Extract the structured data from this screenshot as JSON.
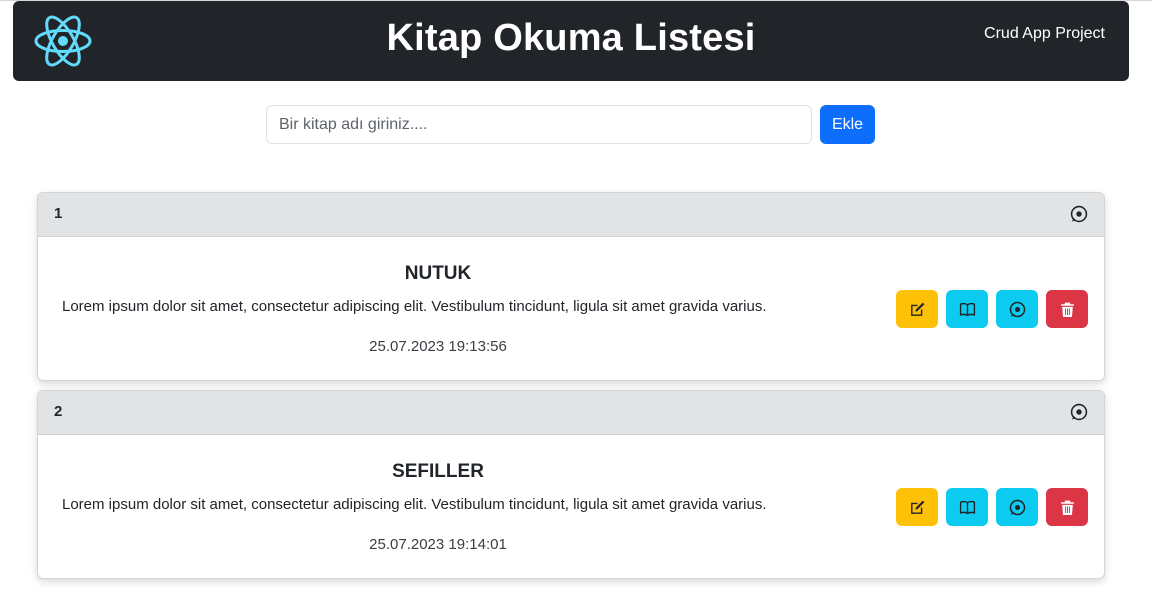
{
  "header": {
    "title": "Kitap Okuma Listesi",
    "link": "Crud App Project"
  },
  "add_form": {
    "placeholder": "Bir kitap adı giriniz....",
    "value": "",
    "button_label": "Ekle"
  },
  "books": [
    {
      "index": "1",
      "title": "NUTUK",
      "description": "Lorem ipsum dolor sit amet, consectetur adipiscing elit. Vestibulum tincidunt, ligula sit amet gravida varius.",
      "date": "25.07.2023 19:13:56"
    },
    {
      "index": "2",
      "title": "SEFILLER",
      "description": "Lorem ipsum dolor sit amet, consectetur adipiscing elit. Vestibulum tincidunt, ligula sit amet gravida varius.",
      "date": "25.07.2023 19:14:01"
    }
  ],
  "icons": {
    "logo": "react-logo-icon",
    "header_comment": "comment-icon",
    "edit": "pencil-square-icon",
    "read": "book-icon",
    "comment": "comment-icon",
    "delete": "trash-icon"
  },
  "colors": {
    "navbar": "#212529",
    "primary": "#0d6efd",
    "warning": "#ffc107",
    "info": "#0dcaf0",
    "danger": "#dc3545",
    "card_header": "#e2e3e5",
    "logo": "#61dafb"
  }
}
